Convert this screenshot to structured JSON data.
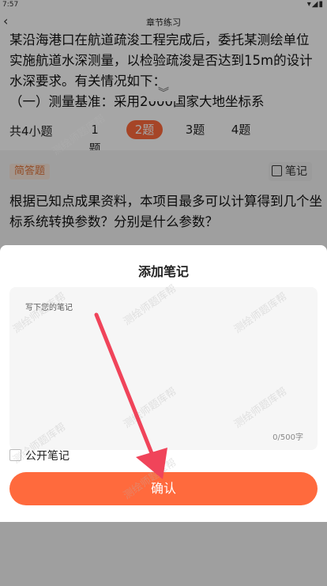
{
  "status": {
    "time": "7:57",
    "icons": "▾◢▮"
  },
  "header": {
    "title": "章节练习",
    "back_icon": "back-arrow-icon"
  },
  "passage": {
    "lines": [
      "某沿海港口在航道疏浚工程完成后，委托某测绘单位",
      "实施航道水深测量，以检验疏浚是否达到15m的设计",
      "水深要求。有关情况如下：",
      "（一）测量基准：采用2000国家大地坐标系"
    ]
  },
  "tabs": {
    "total": "共4小题",
    "items": [
      "1题",
      "2题",
      "3题",
      "4题"
    ],
    "active_index": 1
  },
  "question": {
    "type": "简答题",
    "note_button": "笔记",
    "text": "根据已知点成果资料，本项目最多可以计算得到几个坐标系统转换参数？分别是什么参数？"
  },
  "note_sheet": {
    "title": "添加笔记",
    "placeholder": "写下您的笔记",
    "value": "",
    "counter": "0/500字",
    "public_label": "公开笔记",
    "public_checked": false,
    "confirm_label": "确认"
  },
  "watermark": "测绘师题库帮",
  "colors": {
    "accent": "#ff6a3d",
    "type_badge_bg": "#fbe8dc",
    "type_badge_text": "#e0763c",
    "arrow": "#f0445a"
  }
}
